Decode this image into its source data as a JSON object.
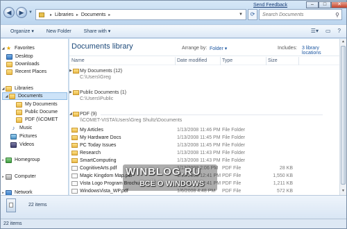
{
  "window": {
    "feedback_link": "Send Feedback",
    "minimize": "–",
    "maximize": "□",
    "close": "✕"
  },
  "address_bar": {
    "crumbs": [
      "Libraries",
      "Documents"
    ],
    "search_placeholder": "Search Documents"
  },
  "toolbar": {
    "items": [
      "Organize ▾",
      "New Folder",
      "Share with ▾"
    ]
  },
  "nav": {
    "favorites": "Favorites",
    "desktop": "Desktop",
    "downloads": "Downloads",
    "recent": "Recent Places",
    "libraries": "Libraries",
    "documents": "Documents",
    "my_documents": "My Documents",
    "public_documents": "Public Docume",
    "pdf": "PDF (\\\\COMET",
    "music": "Music",
    "pictures": "Pictures",
    "videos": "Videos",
    "homegroup": "Homegroup",
    "computer": "Computer",
    "network": "Network"
  },
  "library": {
    "title": "Documents library",
    "arrange_label": "Arrange by:",
    "arrange_value": "Folder ▾",
    "includes_label": "Includes:",
    "includes_value": "3 library locations"
  },
  "columns": {
    "name": "Name",
    "date": "Date modified",
    "type": "Type",
    "size": "Size"
  },
  "groups": [
    {
      "name": "My Documents (12)",
      "path": "C:\\Users\\Greg"
    },
    {
      "name": "Public Documents (1)",
      "path": "C:\\Users\\Public"
    },
    {
      "name": "PDF (9)",
      "path": "\\\\COMET-VISTA\\Users\\Greg Shultz\\Documents"
    }
  ],
  "files": [
    {
      "name": "My Articles",
      "date": "1/13/2008 11:46 PM",
      "type": "File Folder",
      "size": ""
    },
    {
      "name": "My Hardware Docs",
      "date": "1/13/2008 11:45 PM",
      "type": "File Folder",
      "size": ""
    },
    {
      "name": "PC Today Issues",
      "date": "1/13/2008 11:45 PM",
      "type": "File Folder",
      "size": ""
    },
    {
      "name": "Research",
      "date": "1/13/2008 11:43 PM",
      "type": "File Folder",
      "size": ""
    },
    {
      "name": "SmartComputing",
      "date": "1/13/2008 11:43 PM",
      "type": "File Folder",
      "size": ""
    },
    {
      "name": "CognitiveArts.pdf",
      "date": "1/13/2008 2:06 PM",
      "type": "PDF File",
      "size": "28 KB"
    },
    {
      "name": "Magic Kingdom Map.pdf",
      "date": "1/13/2008 12:41 PM",
      "type": "PDF File",
      "size": "1,550 KB"
    },
    {
      "name": "Vista Logo Program Brochure",
      "date": "1/13/2008 12:41 PM",
      "type": "PDF File",
      "size": "1,211 KB"
    },
    {
      "name": "WindowsVista_WP.pdf",
      "date": "1/6/2008 4:48 PM",
      "type": "PDF File",
      "size": "572 KB"
    }
  ],
  "details": {
    "count": "22 items"
  },
  "status": {
    "count": "22 items"
  },
  "watermark": {
    "line1": "WINBLOG.RU",
    "line2": "ВСЁ О WINDOWS"
  }
}
